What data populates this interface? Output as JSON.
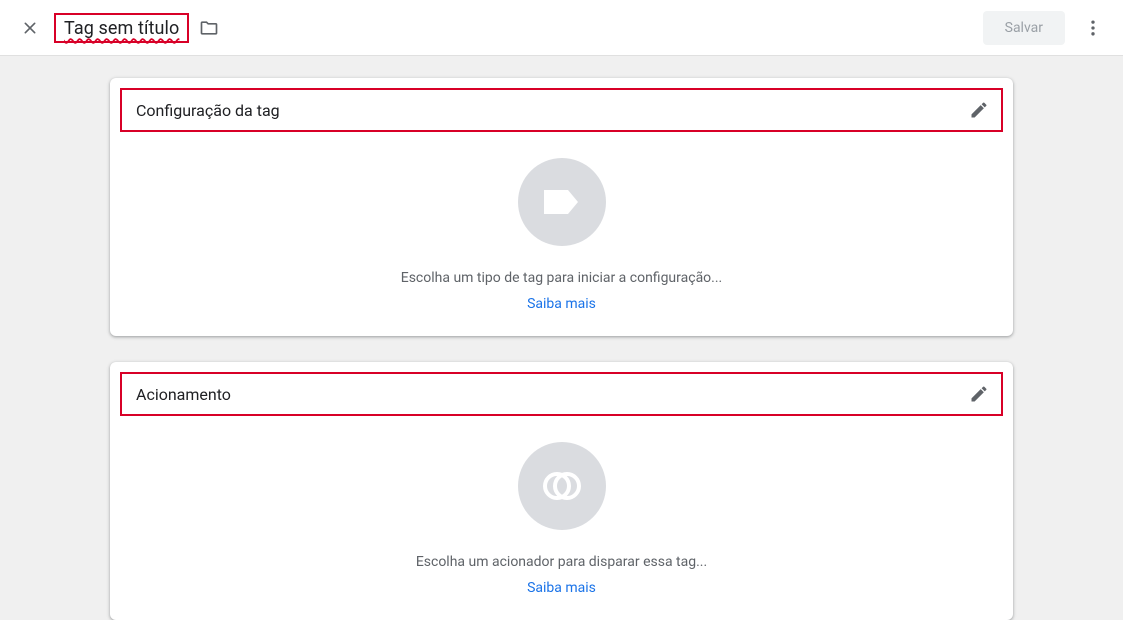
{
  "header": {
    "title": "Tag sem título",
    "save_label": "Salvar"
  },
  "cards": {
    "config": {
      "title": "Configuração da tag",
      "hint": "Escolha um tipo de tag para iniciar a configuração...",
      "learn_more": "Saiba mais"
    },
    "trigger": {
      "title": "Acionamento",
      "hint": "Escolha um acionador para disparar essa tag...",
      "learn_more": "Saiba mais"
    }
  }
}
